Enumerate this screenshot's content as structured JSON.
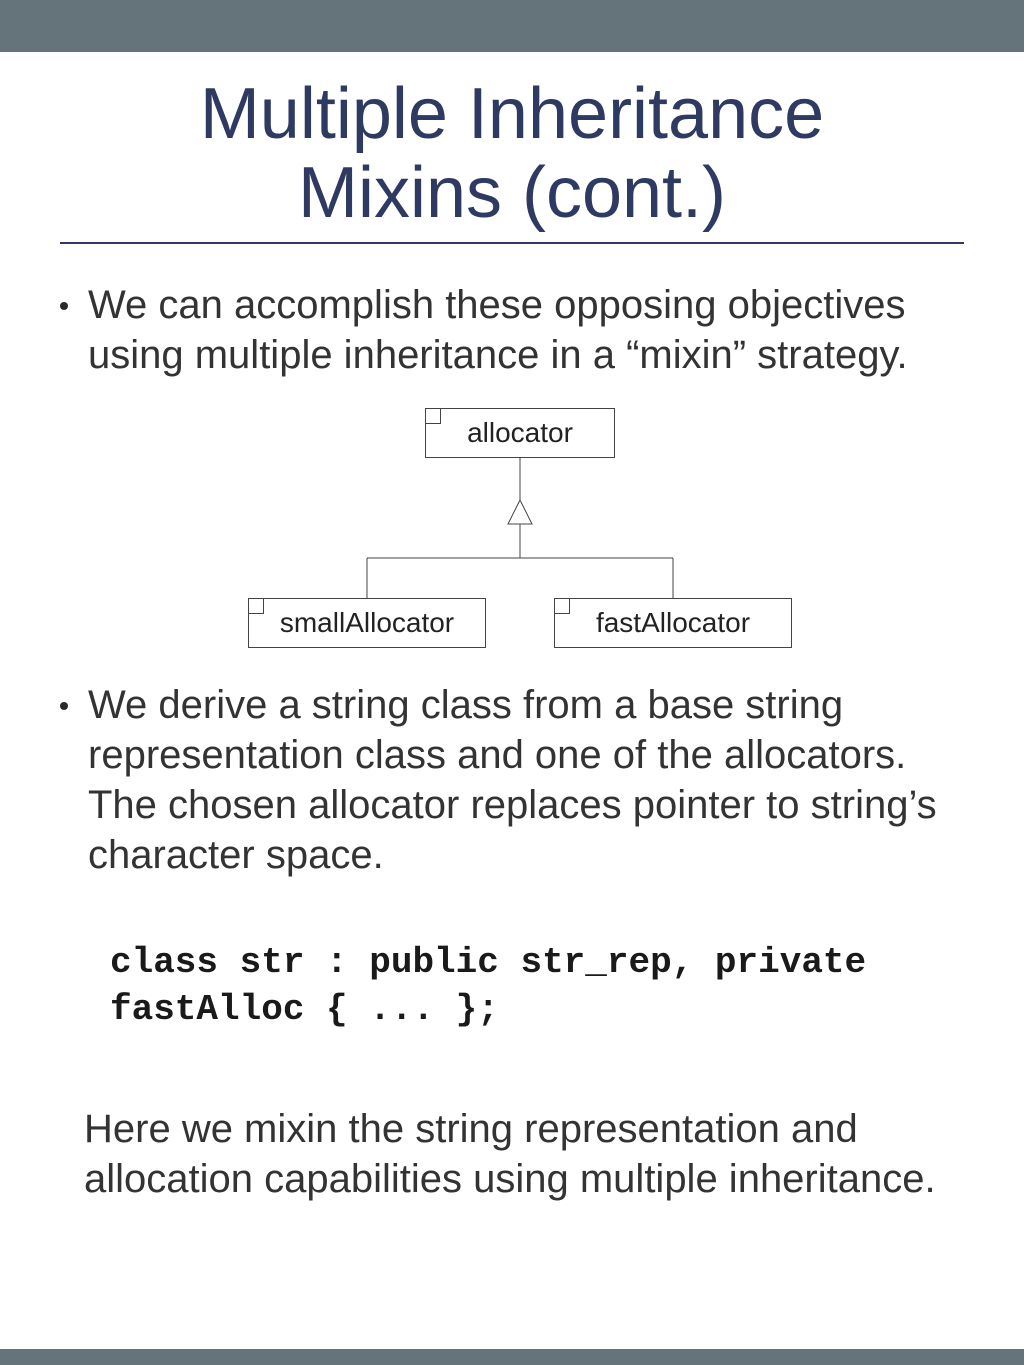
{
  "title": "Multiple Inheritance\nMixins (cont.)",
  "bullets": [
    "We can accomplish these opposing objectives using multiple inheritance in a “mixin” strategy.",
    "We derive a string class from a base string representation class and one of the allocators. The chosen allocator replaces pointer to string’s character space."
  ],
  "diagram": {
    "top": "allocator",
    "left": "smallAllocator",
    "right": "fastAllocator"
  },
  "code": "class str : public str_rep, private fastAlloc { ... };",
  "tail": "Here we mixin the string representation and allocation capabilities using multiple inheritance."
}
